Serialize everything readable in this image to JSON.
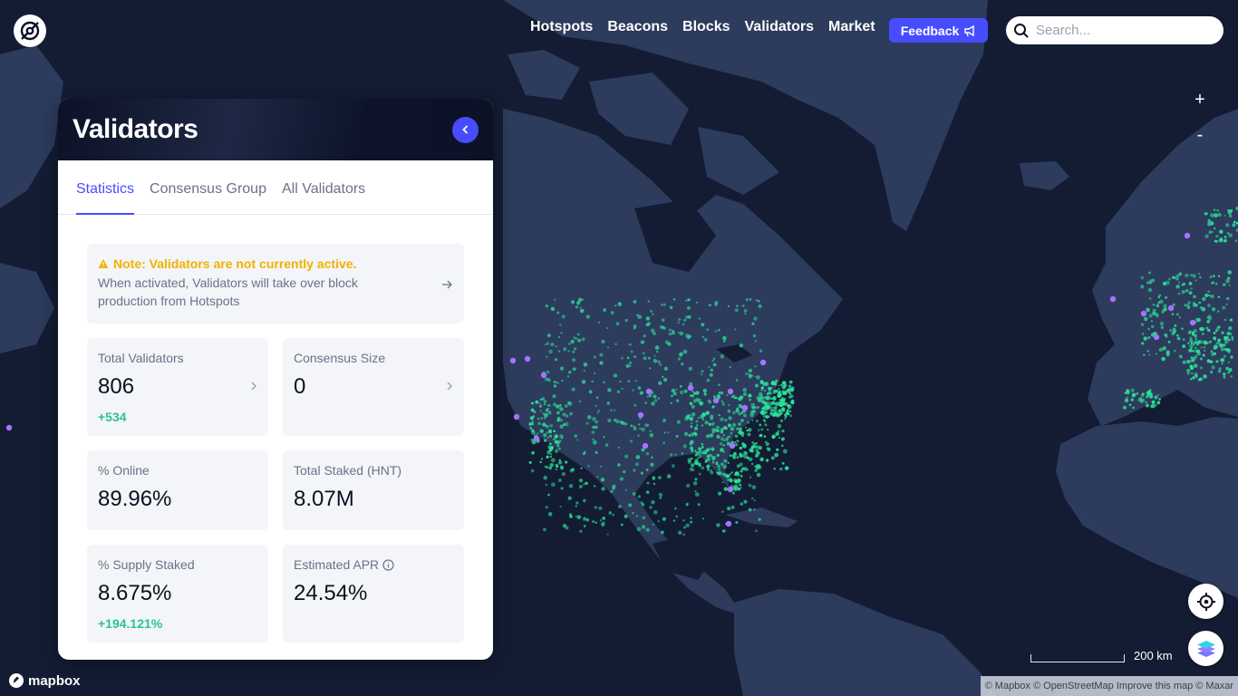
{
  "nav": {
    "links": [
      "Hotspots",
      "Beacons",
      "Blocks",
      "Validators",
      "Market"
    ],
    "feedback_label": "Feedback",
    "search_placeholder": "Search..."
  },
  "map": {
    "zoom_in": "+",
    "zoom_out": "-",
    "scale_label": "200 km",
    "mapbox_label": "mapbox",
    "attribution": "© Mapbox © OpenStreetMap Improve this map © Maxar",
    "colors": {
      "ocean": "#131c33",
      "land": "#2d3b5c",
      "hotspot": "#2be39a",
      "validator": "#a672ff"
    }
  },
  "panel": {
    "title": "Validators",
    "tabs": [
      {
        "label": "Statistics",
        "active": true
      },
      {
        "label": "Consensus Group",
        "active": false
      },
      {
        "label": "All Validators",
        "active": false
      }
    ],
    "note": {
      "title": "Note: Validators are not currently active.",
      "body": "When activated, Validators will take over block production from Hotspots"
    },
    "stats": [
      {
        "label": "Total Validators",
        "value": "806",
        "delta": "+534",
        "link": true
      },
      {
        "label": "Consensus Size",
        "value": "0",
        "delta": "",
        "link": true
      },
      {
        "label": "% Online",
        "value": "89.96%",
        "delta": "",
        "link": false
      },
      {
        "label": "Total Staked (HNT)",
        "value": "8.07M",
        "delta": "",
        "link": false
      },
      {
        "label": "% Supply Staked",
        "value": "8.675%",
        "delta": "+194.121%",
        "link": false
      },
      {
        "label": "Estimated APR",
        "value": "24.54%",
        "delta": "",
        "link": false,
        "info": true
      }
    ]
  },
  "colors": {
    "accent": "#474dff",
    "positive": "#2ac58b",
    "warning": "#f2b100"
  }
}
